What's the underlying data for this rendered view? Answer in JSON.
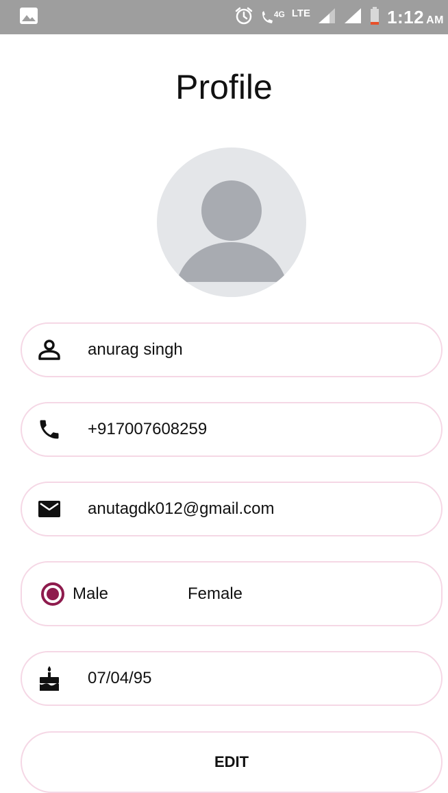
{
  "statusbar": {
    "network": "LTE",
    "network_small": "4G",
    "time": "1:12",
    "ampm": "AM",
    "icons": [
      "image-icon",
      "alarm-icon",
      "wifi-call-icon",
      "signal-icon",
      "signal-icon",
      "battery-icon"
    ],
    "battery_color": "#e8512a"
  },
  "page": {
    "title": "Profile"
  },
  "avatar": {
    "icon": "avatar-placeholder-icon",
    "bg": "#e4e6e9",
    "fg": "#a8abb1"
  },
  "form": {
    "name": {
      "icon": "person-icon",
      "value": "anurag singh"
    },
    "phone": {
      "icon": "phone-icon",
      "value": "+917007608259"
    },
    "email": {
      "icon": "mail-icon",
      "value": "anutagdk012@gmail.com"
    },
    "gender": {
      "options": [
        {
          "label": "Male",
          "selected": true
        },
        {
          "label": "Female",
          "selected": false
        }
      ]
    },
    "dob": {
      "icon": "cake-icon",
      "value": "07/04/95"
    }
  },
  "actions": {
    "edit_label": "EDIT"
  },
  "colors": {
    "accent": "#8e1b4d",
    "field_border": "#f5d7e5",
    "statusbar": "#9e9e9e"
  }
}
